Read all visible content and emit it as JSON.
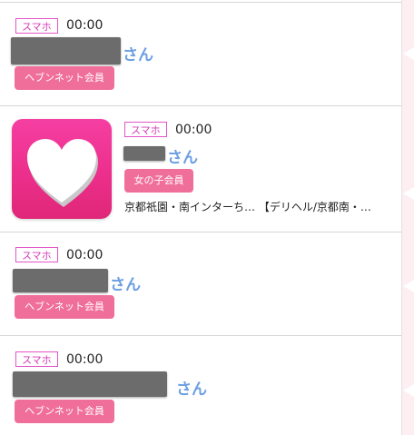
{
  "list": {
    "entries": [
      {
        "device_tag": "スマホ",
        "time": "00:00",
        "honorific": "さん",
        "member_badge": "ヘブンネット会員"
      },
      {
        "device_tag": "スマホ",
        "time": "00:00",
        "honorific": "さん",
        "member_badge": "女の子会員",
        "description": "京都祇園・南インターち… 【デリヘル/京都南・…",
        "avatar_icon": "heart-icon"
      },
      {
        "device_tag": "スマホ",
        "time": "00:00",
        "honorific": "さん",
        "member_badge": "ヘブンネット会員"
      },
      {
        "device_tag": "スマホ",
        "time": "00:00",
        "honorific": "さん",
        "member_badge": "ヘブンネット会員"
      }
    ]
  },
  "colors": {
    "accent_pink": "#f06e9a",
    "tag_border": "#e255c8",
    "name_blue": "#6b9fe3"
  }
}
